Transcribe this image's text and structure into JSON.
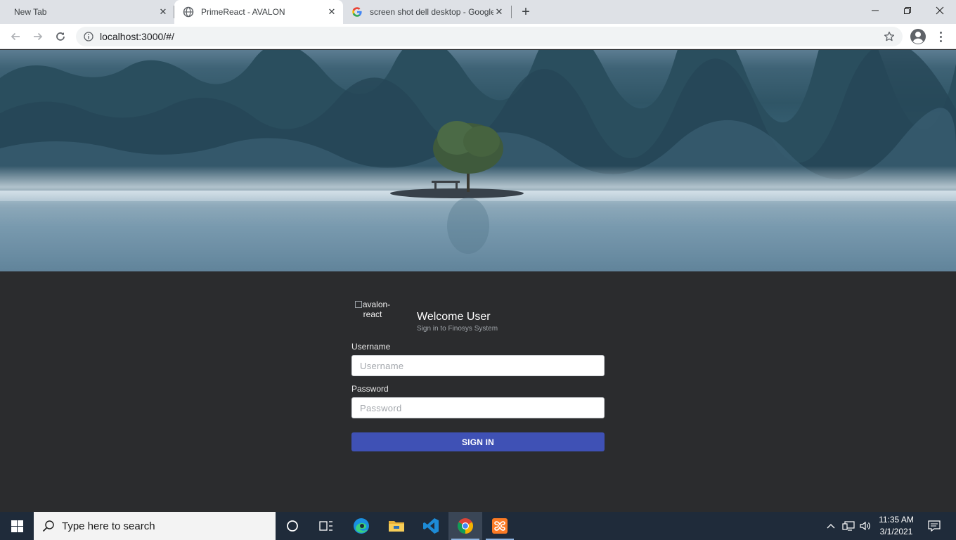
{
  "browser": {
    "tabs": [
      {
        "title": "New Tab",
        "active": false,
        "favicon": "none"
      },
      {
        "title": "PrimeReact - AVALON",
        "active": true,
        "favicon": "globe-icon"
      },
      {
        "title": "screen shot dell desktop - Google",
        "active": false,
        "favicon": "google-icon"
      }
    ],
    "close_glyph": "✕",
    "new_tab_glyph": "+",
    "url": "localhost:3000/#/"
  },
  "login": {
    "logo_alt": "avalon-react",
    "welcome": "Welcome User",
    "subtitle": "Sign in to Finosys System",
    "username_label": "Username",
    "username_placeholder": "Username",
    "username_value": "",
    "password_label": "Password",
    "password_placeholder": "Password",
    "password_value": "",
    "signin_label": "SIGN IN"
  },
  "taskbar": {
    "search_placeholder": "Type here to search",
    "apps": [
      "cortana-icon",
      "task-view-icon",
      "edge-icon",
      "file-explorer-icon",
      "vscode-icon",
      "chrome-icon",
      "xampp-icon"
    ],
    "time": "11:35 AM",
    "date": "3/1/2021"
  },
  "colors": {
    "accent": "#3f51b5",
    "page_bg": "#2b2c2e",
    "taskbar_bg": "#1f2b3a",
    "tabstrip_bg": "#dee1e6"
  }
}
